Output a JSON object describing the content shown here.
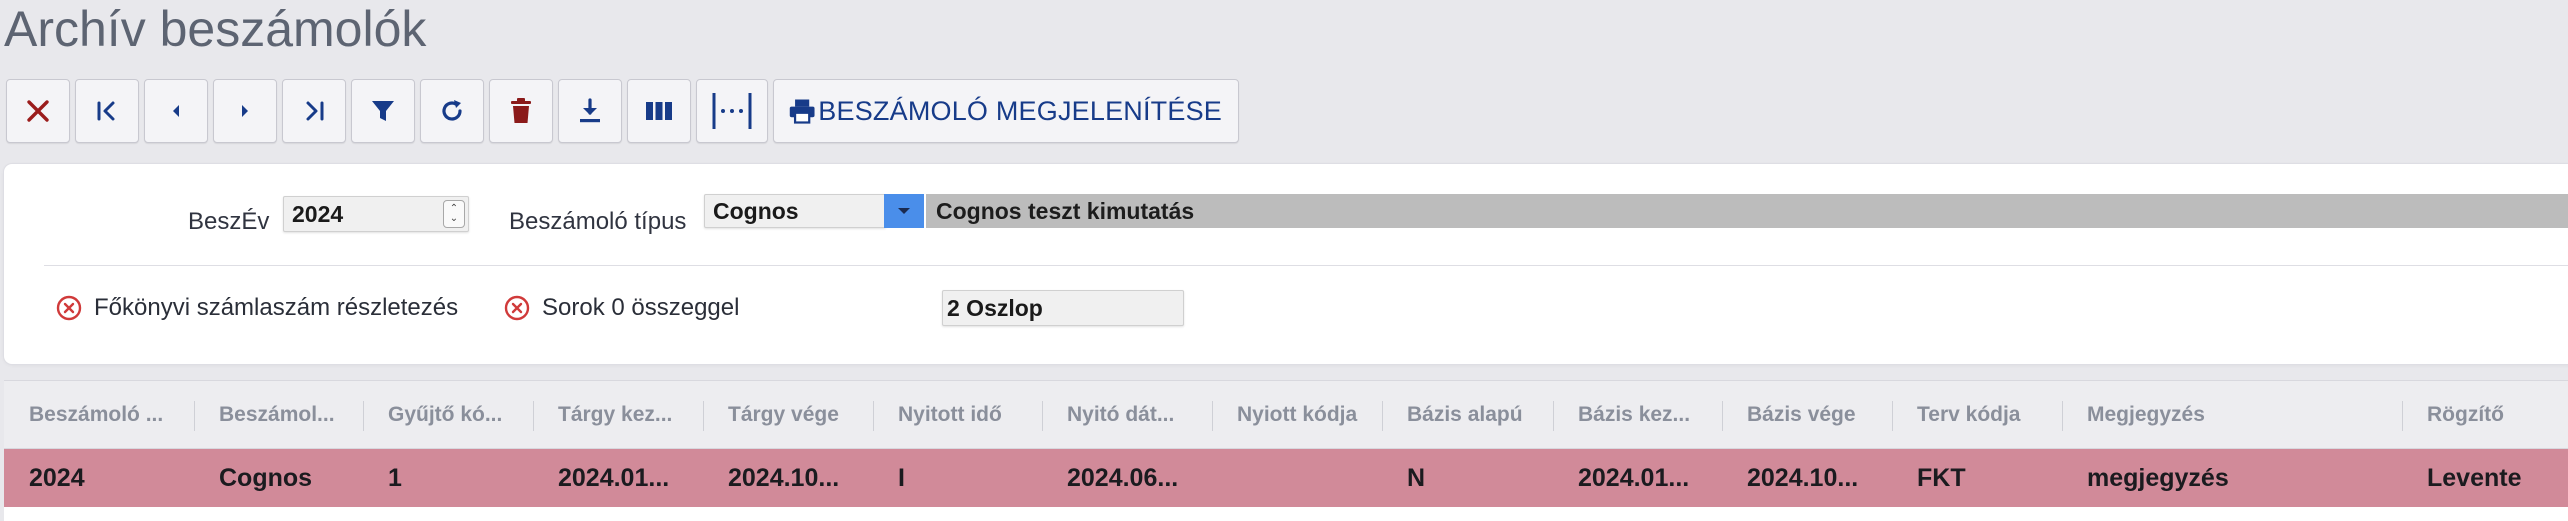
{
  "page": {
    "title": "Archív beszámolók"
  },
  "toolbar": {
    "buttons": [
      {
        "name": "close-button",
        "icon": "close-icon",
        "color": "#9b1c1c"
      },
      {
        "name": "first-record-button",
        "icon": "first-page-icon",
        "color": "#173b89"
      },
      {
        "name": "previous-record-button",
        "icon": "chevron-left-icon",
        "color": "#173b89"
      },
      {
        "name": "next-record-button",
        "icon": "chevron-right-icon",
        "color": "#173b89"
      },
      {
        "name": "last-record-button",
        "icon": "last-page-icon",
        "color": "#173b89"
      },
      {
        "name": "filter-button",
        "icon": "filter-icon",
        "color": "#173b89"
      },
      {
        "name": "refresh-button",
        "icon": "refresh-icon",
        "color": "#173b89"
      },
      {
        "name": "delete-button",
        "icon": "trash-icon",
        "color": "#8b1a1a"
      },
      {
        "name": "download-button",
        "icon": "download-icon",
        "color": "#173b89"
      },
      {
        "name": "columns-button",
        "icon": "columns-icon",
        "color": "#173b89"
      },
      {
        "name": "column-width-button",
        "icon": "column-width-icon",
        "color": "#173b89"
      }
    ],
    "show_report_label": "BESZÁMOLÓ MEGJELENÍTÉSE",
    "show_report_icon": "printer-icon"
  },
  "form": {
    "year_label": "BeszÉv",
    "year_value": "2024",
    "report_type_label": "Beszámoló típus",
    "report_type_value": "Cognos",
    "report_type_description": "Cognos teszt kimutatás",
    "option_ledger_label": "Főkönyvi számlaszám részletezés",
    "option_zero_rows_label": "Sorok 0 összeggel",
    "columns_value": "2 Oszlop",
    "option_icon": "unchecked-circle-x-icon",
    "option_icon_color": "#d03a3a"
  },
  "grid": {
    "columns": [
      "Beszámoló ...",
      "Beszámol...",
      "Gyűjtő kó...",
      "Tárgy kez...",
      "Tárgy vége",
      "Nyitott idő",
      "Nyitó dát...",
      "Nyiott kódja",
      "Bázis alapú",
      "Bázis kez...",
      "Bázis vége",
      "Terv kódja",
      "Megjegyzés",
      "Rögzítő"
    ],
    "rows": [
      {
        "cells": [
          "2024",
          "Cognos",
          "1",
          "2024.01...",
          "2024.10...",
          "I",
          "2024.06...",
          "",
          "N",
          "2024.01...",
          "2024.10...",
          "FKT",
          "megjegyzés",
          "Levente"
        ],
        "selected": true
      }
    ],
    "selected_row_color": "#d18a99"
  },
  "colors": {
    "accent": "#173b89",
    "dropdown_accent": "#4a8eea",
    "background": "#e8e8ec"
  }
}
